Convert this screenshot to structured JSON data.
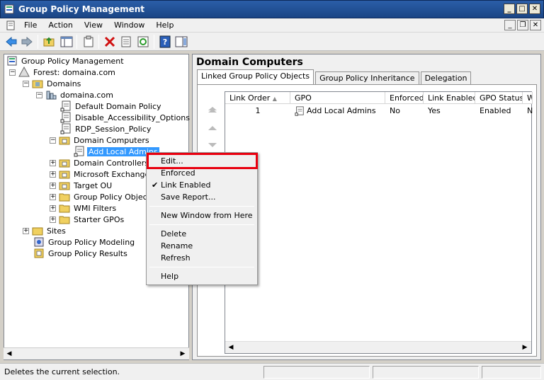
{
  "window": {
    "title": "Group Policy Management"
  },
  "menu": {
    "items": [
      "File",
      "Action",
      "View",
      "Window",
      "Help"
    ]
  },
  "tree": {
    "items": [
      {
        "label": "Group Policy Management",
        "icon": "gpm-root-icon"
      },
      {
        "label": "Forest: domaina.com",
        "icon": "forest-icon"
      },
      {
        "label": "Domains",
        "icon": "domains-icon"
      },
      {
        "label": "domaina.com",
        "icon": "domain-icon"
      },
      {
        "label": "Default Domain Policy",
        "icon": "gpo-link-icon"
      },
      {
        "label": "Disable_Accessibility_Options",
        "icon": "gpo-link-icon"
      },
      {
        "label": "RDP_Session_Policy",
        "icon": "gpo-link-icon"
      },
      {
        "label": "Domain Computers",
        "icon": "ou-icon"
      },
      {
        "label": "Add Local Admins",
        "icon": "gpo-link-icon"
      },
      {
        "label": "Domain Controllers",
        "icon": "ou-icon"
      },
      {
        "label": "Microsoft Exchange S",
        "icon": "ou-icon"
      },
      {
        "label": "Target OU",
        "icon": "ou-icon"
      },
      {
        "label": "Group Policy Objects",
        "icon": "folder-icon"
      },
      {
        "label": "WMI Filters",
        "icon": "folder-icon"
      },
      {
        "label": "Starter GPOs",
        "icon": "folder-icon"
      },
      {
        "label": "Sites",
        "icon": "sites-icon"
      },
      {
        "label": "Group Policy Modeling",
        "icon": "modeling-icon"
      },
      {
        "label": "Group Policy Results",
        "icon": "results-icon"
      }
    ]
  },
  "details": {
    "title": "Domain Computers",
    "tabs": [
      "Linked Group Policy Objects",
      "Group Policy Inheritance",
      "Delegation"
    ],
    "columns": [
      "Link Order",
      "GPO",
      "Enforced",
      "Link Enabled",
      "GPO Status",
      "W"
    ],
    "rows": [
      {
        "link_order": "1",
        "gpo": "Add Local Admins",
        "enforced": "No",
        "link_enabled": "Yes",
        "gpo_status": "Enabled",
        "w": "N"
      }
    ]
  },
  "context_menu": {
    "items": [
      "Edit...",
      "Enforced",
      "Link Enabled",
      "Save Report...",
      "New Window from Here",
      "Delete",
      "Rename",
      "Refresh",
      "Help"
    ]
  },
  "status": {
    "text": "Deletes the current selection."
  },
  "colors": {
    "highlight": "#e8000f",
    "selection": "#3399ff"
  }
}
